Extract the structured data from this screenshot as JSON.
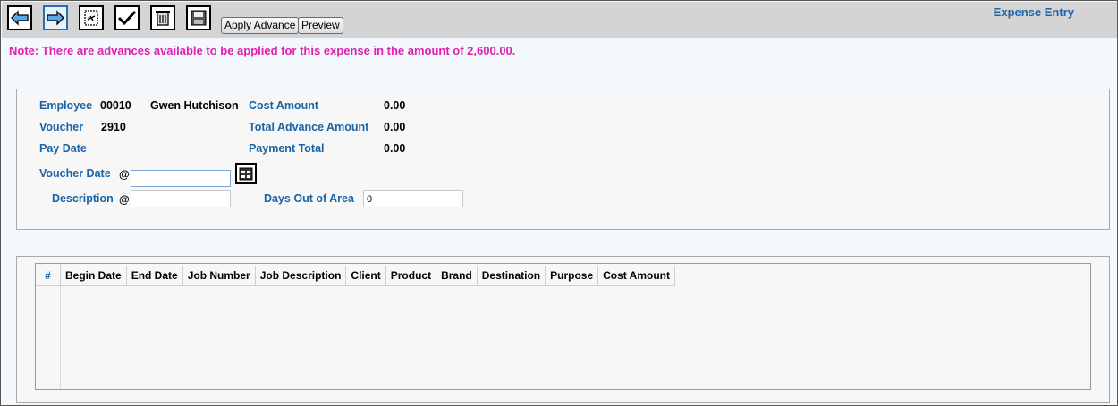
{
  "header": {
    "title": "Expense Entry",
    "buttons": {
      "apply_advance": "Apply Advance",
      "preview": "Preview"
    },
    "icons": [
      "back-arrow-icon",
      "forward-arrow-icon",
      "travel-document-icon",
      "checkmark-icon",
      "trash-icon",
      "save-disk-icon"
    ]
  },
  "note": "Note: There are advances available to be applied for this expense in the amount of 2,600.00.",
  "form": {
    "employee_label": "Employee",
    "employee_id": "00010",
    "employee_name": "Gwen Hutchison",
    "voucher_label": "Voucher",
    "voucher_number": "2910",
    "pay_date_label": "Pay Date",
    "cost_amount_label": "Cost Amount",
    "cost_amount": "0.00",
    "total_advance_label": "Total Advance Amount",
    "total_advance": "0.00",
    "payment_total_label": "Payment Total",
    "payment_total": "0.00",
    "voucher_date_label": "Voucher Date",
    "voucher_date_value": "",
    "description_label": "Description",
    "description_value": "",
    "required_marker": "@",
    "days_out_label": "Days Out of Area",
    "days_out_value": "0"
  },
  "table": {
    "columns": [
      "#",
      "Begin Date",
      "End Date",
      "Job Number",
      "Job Description",
      "Client",
      "Product",
      "Brand",
      "Destination",
      "Purpose",
      "Cost Amount"
    ],
    "rows": []
  },
  "colors": {
    "label_blue": "#1a64a6",
    "note_magenta": "#e020b0",
    "toolbar_gray": "#d4d4d4"
  }
}
